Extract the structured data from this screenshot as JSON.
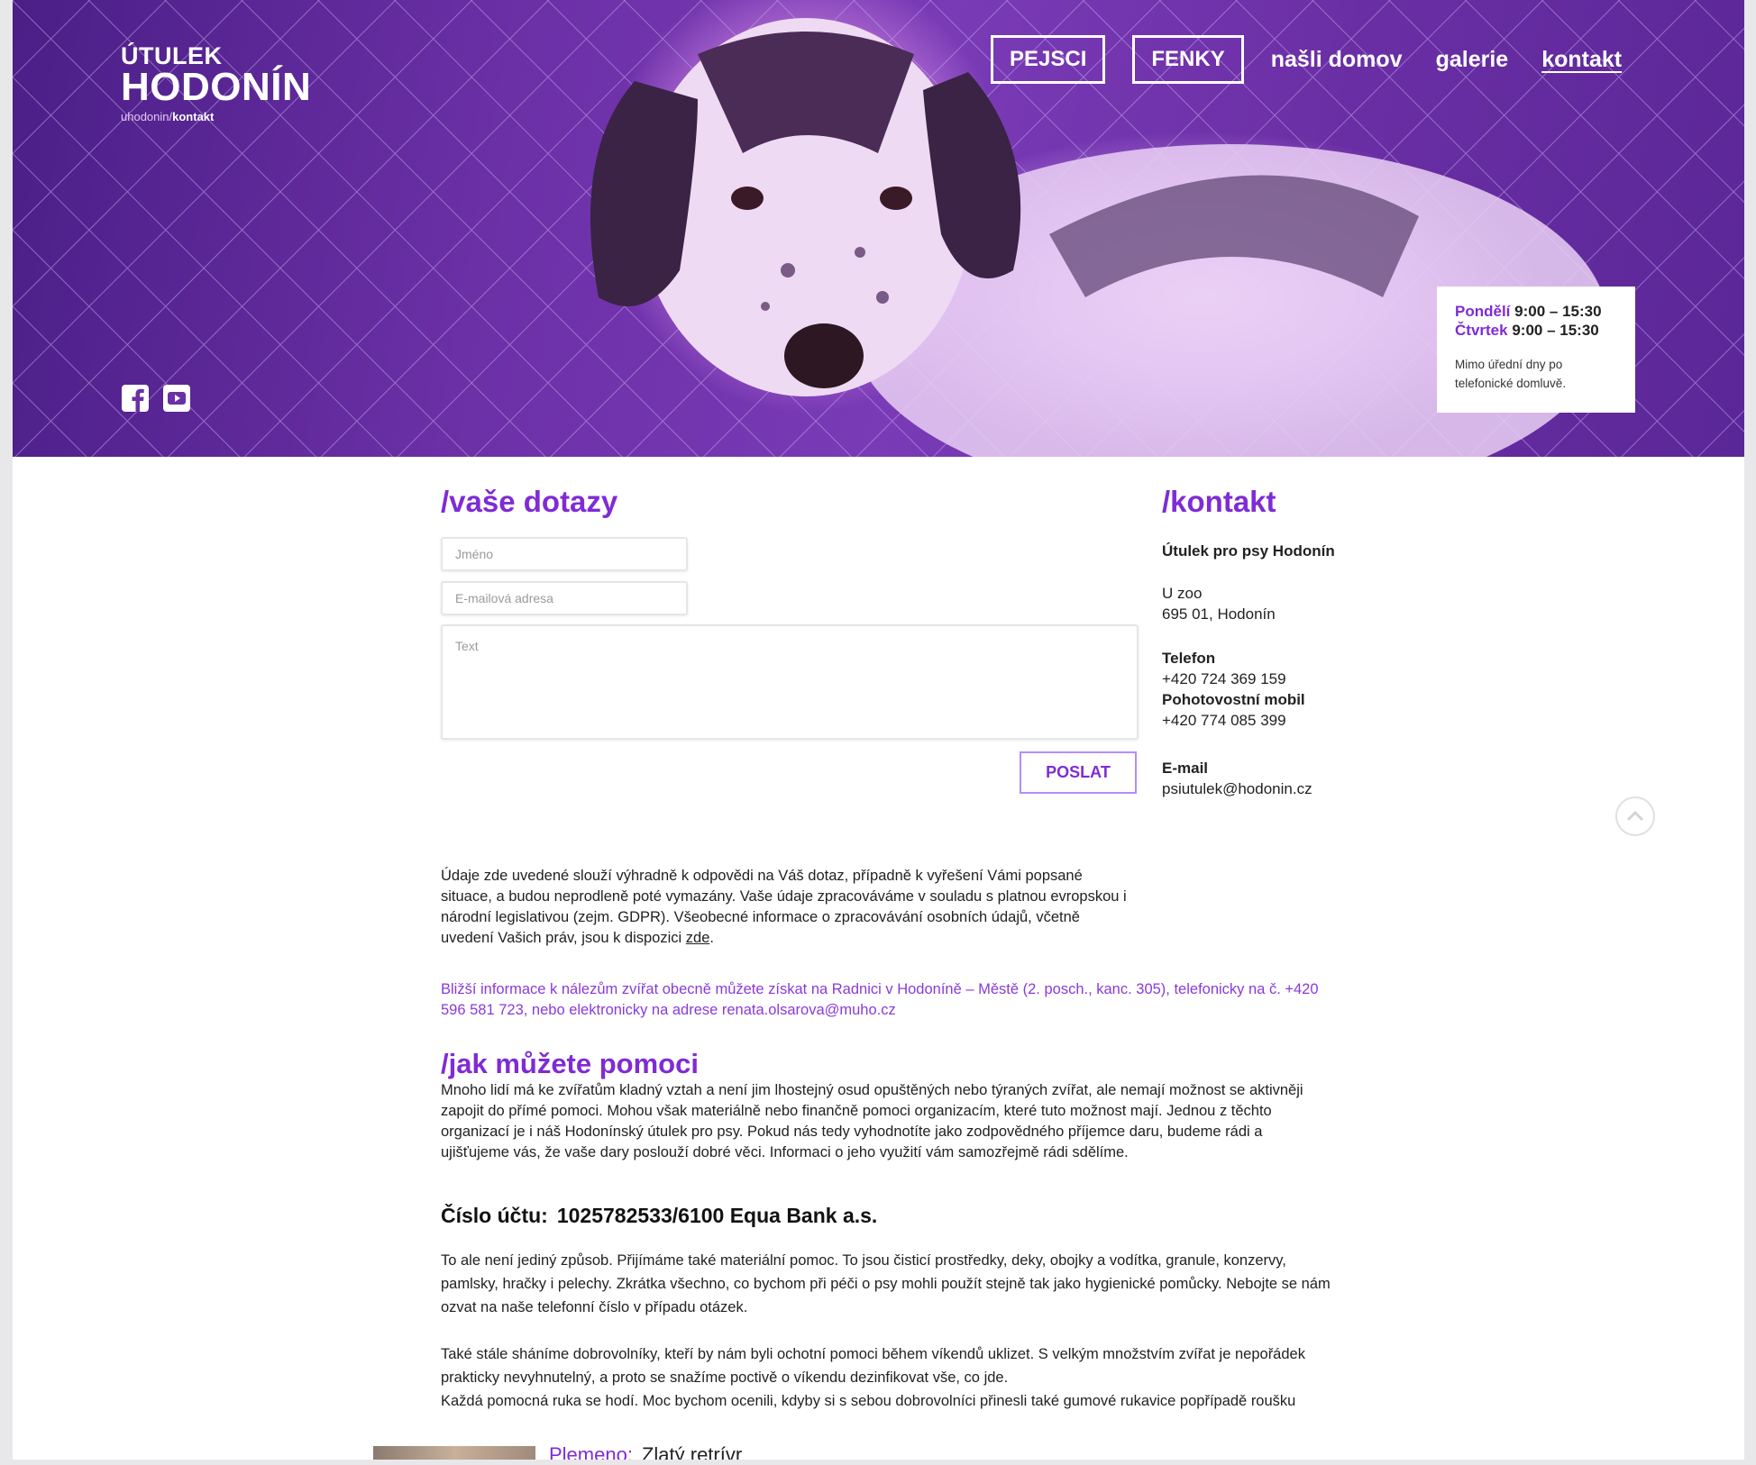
{
  "header": {
    "logo_line1": "ÚTULEK",
    "logo_line2": "HODONÍN",
    "breadcrumb_parent": "uhodonin",
    "breadcrumb_sep": "/",
    "breadcrumb_current": "kontakt",
    "nav": [
      "PEJSCI",
      "FENKY",
      "našli domov",
      "galerie",
      "kontakt"
    ],
    "social_icons": [
      "facebook-icon",
      "youtube-icon"
    ],
    "hours": {
      "day1": "Pondělí",
      "time1": "9:00 – 15:30",
      "day2": "Čtvrtek",
      "time2": "9:00 – 15:30",
      "note": "Mimo úřední dny po telefonické domluvě."
    }
  },
  "form": {
    "title": "/vaše dotazy",
    "name_placeholder": "Jméno",
    "email_placeholder": "E-mailová adresa",
    "text_placeholder": "Text",
    "submit_label": "POSLAT"
  },
  "contact": {
    "title": "/kontakt",
    "org": "Útulek pro psy Hodonín",
    "street": "U zoo",
    "city": "695 01, Hodonín",
    "phone_label": "Telefon",
    "phone": "+420 724 369 159",
    "mobile_label": "Pohotovostní mobil",
    "mobile": "+420 774 085 399",
    "email_label": "E-mail",
    "email": "psiutulek@hodonin.cz"
  },
  "gdpr": {
    "text": "Údaje zde uvedené slouží výhradně k odpovědi na Váš dotaz, případně k vyřešení Vámi popsané situace, a budou neprodleně poté vymazány. Vaše údaje zpracováváme v souladu s platnou evropskou i národní legislativou (zejm. GDPR). Všeobecné informace o zpracovávání osobních údajů, včetně uvedení Vašich práv, jsou k dispozici ",
    "link": "zde",
    "end": "."
  },
  "info": "Bližší informace k nálezům zvířat obecně můžete získat na Radnici v Hodoníně – Městě (2. posch., kanc. 305), telefonicky na č. +420 596 581 723, nebo elektronicky na adrese renata.olsarova@muho.cz",
  "help": {
    "title": "/jak můžete pomoci",
    "text": "Mnoho lidí má ke zvířatům kladný vztah a není jim lhostejný osud opuštěných nebo týraných zvířat, ale nemají možnost se aktivněji zapojit do přímé pomoci. Mohou však materiálně nebo finančně pomoci organizacím, které tuto možnost mají. Jednou z těchto organizací je i náš Hodonínský útulek pro psy. Pokud nás tedy vyhodnotíte jako zodpovědného příjemce daru, budeme rádi a ujišťujeme vás, že vaše dary poslouží dobré věci. Informaci o jeho využití vám samozřejmě rádi sdělíme.",
    "account_label": "Číslo účtu:",
    "account_value": "1025782533/6100 Equa Bank a.s.",
    "material": "To ale není jediný způsob. Přijímáme také materiální pomoc. To jsou čisticí prostředky, deky, obojky a vodítka, granule, konzervy, pamlsky, hračky i pelechy. Zkrátka všechno, co bychom při péči o psy mohli použít stejně tak jako hygienické pomůcky. Nebojte se nám ozvat na naše telefonní číslo v případu otázek.",
    "volunteers1": "Také stále sháníme dobrovolníky, kteří by nám byli ochotní pomoci během víkendů uklizet. S velkým množstvím zvířat je nepořádek prakticky nevyhnutelný, a proto se snažíme poctivě o víkendu dezinfikovat vše, co jde.",
    "volunteers2": "Každá pomocná ruka se hodí. Moc bychom ocenili, kdyby si s sebou dobrovolníci přinesli také gumové rukavice popřípadě roušku"
  },
  "peek": {
    "label": "Plemeno:",
    "value": "Zlatý retrívr"
  },
  "colors": {
    "accent": "#7f2bd6",
    "hero_tint": "#6b2fa6"
  }
}
